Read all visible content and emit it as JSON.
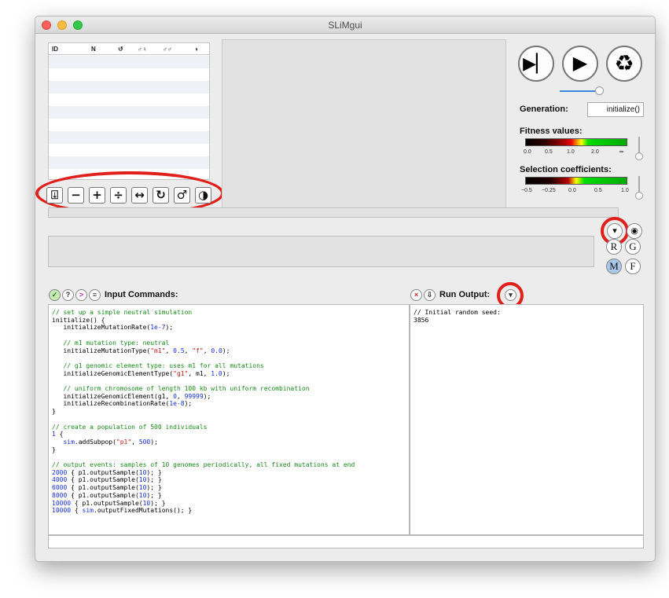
{
  "window": {
    "title": "SLiMgui"
  },
  "subpop_table": {
    "columns": [
      "ID",
      "N",
      "↺",
      "♂♀",
      "♂♂",
      "◑"
    ]
  },
  "toolbar": {
    "icons": [
      "add-subpop-icon",
      "minus-icon",
      "plus-icon",
      "divide-icon",
      "arrows-icon",
      "refresh-icon",
      "sex-icon",
      "yinyang-icon"
    ],
    "glyphs": [
      "⍗",
      "−",
      "+",
      "÷",
      "↔",
      "↻",
      "♂",
      "◑"
    ]
  },
  "controls": {
    "step_glyph": "▶▏",
    "play_glyph": "▶",
    "recycle_glyph": "♻",
    "speed": 0.9
  },
  "generation": {
    "label": "Generation:",
    "value": "initialize()"
  },
  "fitness": {
    "label": "Fitness values:",
    "ticks": [
      "0.0",
      "0.5",
      "1.0",
      "2.0",
      "∞"
    ],
    "slider": 0.1
  },
  "selection": {
    "label": "Selection coefficients:",
    "ticks": [
      "−0.5",
      "−0.25",
      "0.0",
      "0.5",
      "1.0"
    ],
    "slider": 0.1
  },
  "chromosome_buttons": {
    "R": "R",
    "G": "G",
    "M": "M",
    "F": "F",
    "dropdown": "▾",
    "eye": "◉"
  },
  "input": {
    "label": "Input Commands:",
    "buttons": {
      "check": "✓",
      "help": "?",
      "run": ">",
      "list": "≡"
    }
  },
  "output": {
    "label": "Run Output:",
    "clear": "×",
    "dump": "⇩",
    "dropdown": "▾",
    "lines": [
      "// Initial random seed:",
      "3856"
    ]
  },
  "script": [
    [
      {
        "t": "// set up a simple neutral simulation",
        "c": "com"
      }
    ],
    [
      {
        "t": "initialize() {"
      }
    ],
    [
      {
        "t": "   initializeMutationRate("
      },
      {
        "t": "1e-7",
        "c": "num"
      },
      {
        "t": ");"
      }
    ],
    [
      {
        "t": ""
      }
    ],
    [
      {
        "t": "   // m1 mutation type: neutral",
        "c": "com"
      }
    ],
    [
      {
        "t": "   initializeMutationType("
      },
      {
        "t": "\"m1\"",
        "c": "str"
      },
      {
        "t": ", "
      },
      {
        "t": "0.5",
        "c": "num"
      },
      {
        "t": ", "
      },
      {
        "t": "\"f\"",
        "c": "str"
      },
      {
        "t": ", "
      },
      {
        "t": "0.0",
        "c": "num"
      },
      {
        "t": ");"
      }
    ],
    [
      {
        "t": ""
      }
    ],
    [
      {
        "t": "   // g1 genomic element type: uses m1 for all mutations",
        "c": "com"
      }
    ],
    [
      {
        "t": "   initializeGenomicElementType("
      },
      {
        "t": "\"g1\"",
        "c": "str"
      },
      {
        "t": ", m1, "
      },
      {
        "t": "1.0",
        "c": "num"
      },
      {
        "t": ");"
      }
    ],
    [
      {
        "t": ""
      }
    ],
    [
      {
        "t": "   // uniform chromosome of length 100 kb with uniform recombination",
        "c": "com"
      }
    ],
    [
      {
        "t": "   initializeGenomicElement(g1, "
      },
      {
        "t": "0",
        "c": "num"
      },
      {
        "t": ", "
      },
      {
        "t": "99999",
        "c": "num"
      },
      {
        "t": ");"
      }
    ],
    [
      {
        "t": "   initializeRecombinationRate("
      },
      {
        "t": "1e-8",
        "c": "num"
      },
      {
        "t": ");"
      }
    ],
    [
      {
        "t": "}"
      }
    ],
    [
      {
        "t": ""
      }
    ],
    [
      {
        "t": "// create a population of 500 individuals",
        "c": "com"
      }
    ],
    [
      {
        "t": "1",
        "c": "num"
      },
      {
        "t": " {"
      }
    ],
    [
      {
        "t": "   "
      },
      {
        "t": "sim",
        "c": "num"
      },
      {
        "t": ".addSubpop("
      },
      {
        "t": "\"p1\"",
        "c": "str"
      },
      {
        "t": ", "
      },
      {
        "t": "500",
        "c": "num"
      },
      {
        "t": ");"
      }
    ],
    [
      {
        "t": "}"
      }
    ],
    [
      {
        "t": ""
      }
    ],
    [
      {
        "t": "// output events: samples of 10 genomes periodically, all fixed mutations at end",
        "c": "com"
      }
    ],
    [
      {
        "t": "2000",
        "c": "num"
      },
      {
        "t": " { p1.outputSample("
      },
      {
        "t": "10",
        "c": "num"
      },
      {
        "t": "); }"
      }
    ],
    [
      {
        "t": "4000",
        "c": "num"
      },
      {
        "t": " { p1.outputSample("
      },
      {
        "t": "10",
        "c": "num"
      },
      {
        "t": "); }"
      }
    ],
    [
      {
        "t": "6000",
        "c": "num"
      },
      {
        "t": " { p1.outputSample("
      },
      {
        "t": "10",
        "c": "num"
      },
      {
        "t": "); }"
      }
    ],
    [
      {
        "t": "8000",
        "c": "num"
      },
      {
        "t": " { p1.outputSample("
      },
      {
        "t": "10",
        "c": "num"
      },
      {
        "t": "); }"
      }
    ],
    [
      {
        "t": "10000",
        "c": "num"
      },
      {
        "t": " { p1.outputSample("
      },
      {
        "t": "10",
        "c": "num"
      },
      {
        "t": "); }"
      }
    ],
    [
      {
        "t": "10000",
        "c": "num"
      },
      {
        "t": " { "
      },
      {
        "t": "sim",
        "c": "num"
      },
      {
        "t": ".outputFixedMutations(); }"
      }
    ]
  ],
  "colors": {
    "annotation": "#e0201b",
    "accent": "#3d86dd"
  }
}
